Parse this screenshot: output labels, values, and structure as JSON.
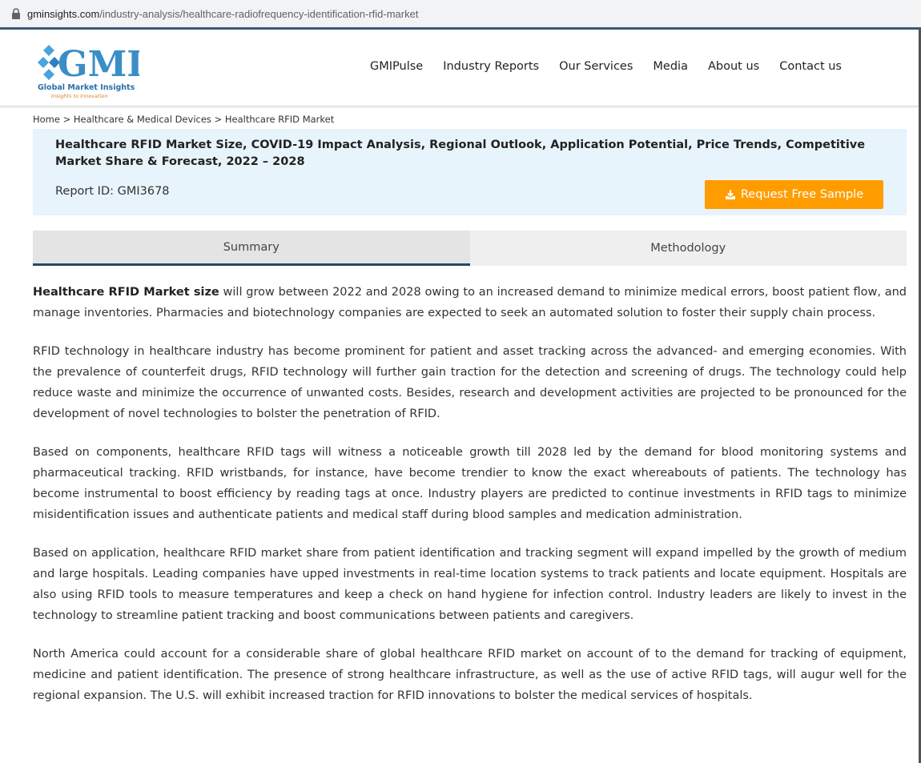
{
  "browser": {
    "url_domain": "gminsights.com",
    "url_path": "/industry-analysis/healthcare-radiofrequency-identification-rfid-market"
  },
  "logo": {
    "text": "GMI",
    "name": "Global Market Insights",
    "tagline": "Insights to Innovation"
  },
  "nav": {
    "items": [
      {
        "label": "GMIPulse"
      },
      {
        "label": "Industry Reports"
      },
      {
        "label": "Our Services"
      },
      {
        "label": "Media"
      },
      {
        "label": "About us"
      },
      {
        "label": "Contact us"
      }
    ]
  },
  "breadcrumb": "Home > Healthcare & Medical Devices > Healthcare RFID Market",
  "report": {
    "title": "Healthcare RFID Market Size, COVID-19 Impact Analysis, Regional Outlook, Application Potential, Price Trends, Competitive Market Share & Forecast, 2022 – 2028",
    "id_label": "Report ID: GMI3678",
    "sample_button": "Request Free Sample"
  },
  "tabs": [
    {
      "label": "Summary",
      "active": true
    },
    {
      "label": "Methodology",
      "active": false
    }
  ],
  "content": {
    "p1_strong": "Healthcare RFID Market size",
    "p1_rest": " will grow between 2022 and 2028 owing to an increased demand to minimize medical errors, boost patient flow, and manage inventories. Pharmacies and biotechnology companies are expected to seek an automated solution to foster their supply chain process.",
    "p2": "RFID technology in healthcare industry has become prominent for patient and asset tracking across the advanced- and emerging economies. With the prevalence of counterfeit drugs, RFID technology will further gain traction for the detection and screening of drugs. The technology could help reduce waste and minimize the occurrence of unwanted costs. Besides, research and development activities are projected to be pronounced for the development of novel technologies to bolster the penetration of RFID.",
    "p3": "Based on components, healthcare RFID tags will witness a noticeable growth till 2028 led by the demand for blood monitoring systems and pharmaceutical tracking. RFID wristbands, for instance, have become trendier to know the exact whereabouts of patients. The technology has become instrumental to boost efficiency by reading tags at once. Industry players are predicted to continue investments in RFID tags to minimize misidentification issues and authenticate patients and medical staff during blood samples and medication administration.",
    "p4": "Based on application, healthcare RFID market share from patient identification and tracking segment will expand impelled by the growth of medium and large hospitals. Leading companies have upped investments in real-time location systems to track patients and locate equipment. Hospitals are also using RFID tools to measure temperatures and keep a check on hand hygiene for infection control. Industry leaders are likely to invest in the technology to streamline patient tracking and boost communications between patients and caregivers.",
    "p5": "North America could account for a considerable share of global healthcare RFID market on account of to the demand for tracking of equipment, medicine and patient identification. The presence of strong healthcare infrastructure, as well as the use of active RFID tags, will augur well for the regional expansion. The U.S. will exhibit increased traction for RFID innovations to bolster the medical services of hospitals."
  },
  "colors": {
    "accent_orange": "#ff9d00",
    "panel_blue": "#e8f4fc",
    "tab_underline": "#1f4a6d",
    "logo_blue": "#3a8ec6"
  },
  "icons": {
    "address_bar": "lock-icon",
    "sample_button": "download-icon",
    "logo_mark": "diamond-logo-icon"
  }
}
